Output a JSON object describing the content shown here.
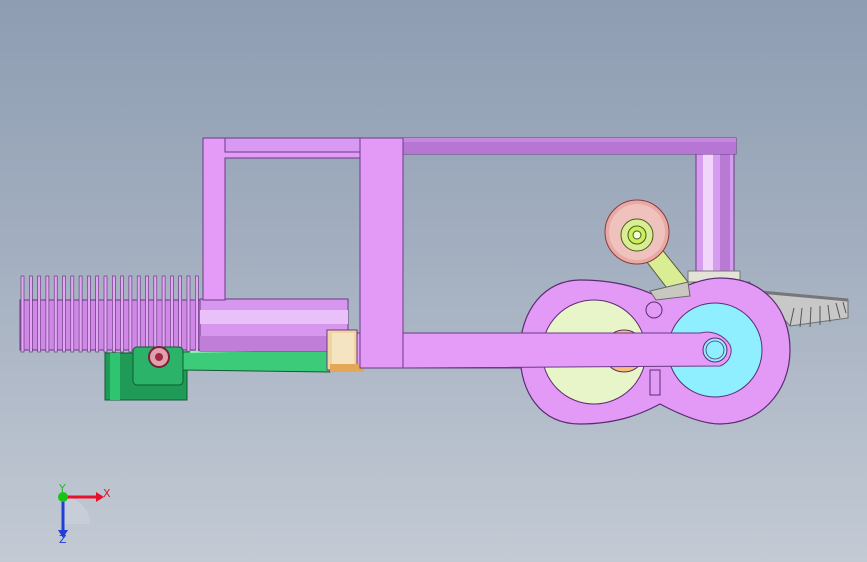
{
  "viewport": {
    "background_top": "#8e9db2",
    "background_bottom": "#c3cad4"
  },
  "colors": {
    "frame": "#e49af7",
    "frame_dark": "#b56ed1",
    "frame_edge": "#6a3a85",
    "fins": "#d08ae8",
    "green_part": "#2bb36a",
    "cam_light_green": "#e8f5c9",
    "cam_cyan": "#8fefff",
    "orange_bearing": "#f5c07a",
    "roller": "#e8a9a3",
    "roller_inner": "#c6f05a",
    "arm": "#d8ec90",
    "gear": "#d9d9d9",
    "post": "#d29cf0"
  },
  "model": {
    "parts": [
      "top-rail",
      "left-vertical-frame",
      "center-vertical-frame",
      "right-post",
      "cylinder",
      "cooling-fins",
      "green-carburetor",
      "connecting-rod",
      "crank-case",
      "idler-roller",
      "rocker-arm",
      "bevel-gear"
    ]
  },
  "triad": {
    "x_label": "X",
    "y_label": "Y",
    "z_label": "Z",
    "x_color": "#e8102a",
    "y_color": "#18c418",
    "z_color": "#1f3fd8"
  }
}
